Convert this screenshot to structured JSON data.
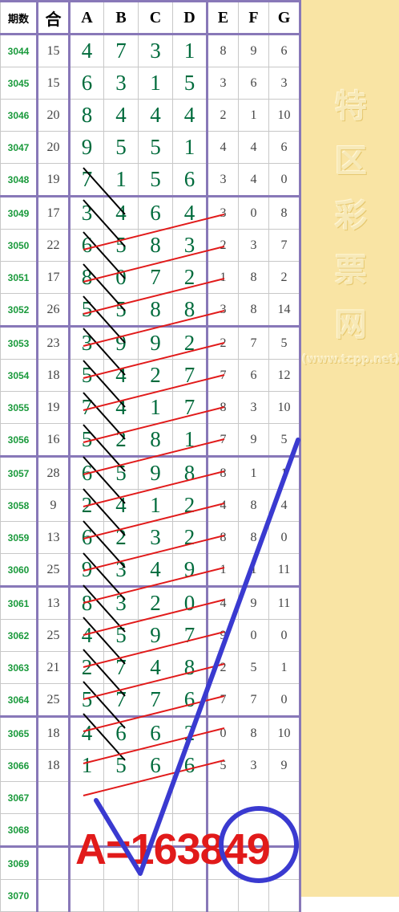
{
  "header": {
    "qi": "期数",
    "he": "合",
    "cols": [
      "A",
      "B",
      "C",
      "D",
      "E",
      "F",
      "G"
    ]
  },
  "rows": [
    {
      "qi": "3044",
      "he": "15",
      "v": [
        "4",
        "7",
        "3",
        "1",
        "8",
        "9",
        "6"
      ]
    },
    {
      "qi": "3045",
      "he": "15",
      "v": [
        "6",
        "3",
        "1",
        "5",
        "3",
        "6",
        "3"
      ]
    },
    {
      "qi": "3046",
      "he": "20",
      "v": [
        "8",
        "4",
        "4",
        "4",
        "2",
        "1",
        "10"
      ]
    },
    {
      "qi": "3047",
      "he": "20",
      "v": [
        "9",
        "5",
        "5",
        "1",
        "4",
        "4",
        "6"
      ]
    },
    {
      "qi": "3048",
      "he": "19",
      "v": [
        "7",
        "1",
        "5",
        "6",
        "3",
        "4",
        "0"
      ]
    },
    {
      "qi": "3049",
      "he": "17",
      "v": [
        "3",
        "4",
        "6",
        "4",
        "3",
        "0",
        "8"
      ]
    },
    {
      "qi": "3050",
      "he": "22",
      "v": [
        "6",
        "5",
        "8",
        "3",
        "2",
        "3",
        "7"
      ]
    },
    {
      "qi": "3051",
      "he": "17",
      "v": [
        "8",
        "0",
        "7",
        "2",
        "1",
        "8",
        "2"
      ]
    },
    {
      "qi": "3052",
      "he": "26",
      "v": [
        "5",
        "5",
        "8",
        "8",
        "3",
        "8",
        "14"
      ]
    },
    {
      "qi": "3053",
      "he": "23",
      "v": [
        "3",
        "9",
        "9",
        "2",
        "2",
        "7",
        "5"
      ]
    },
    {
      "qi": "3054",
      "he": "18",
      "v": [
        "5",
        "4",
        "2",
        "7",
        "7",
        "6",
        "12"
      ]
    },
    {
      "qi": "3055",
      "he": "19",
      "v": [
        "7",
        "4",
        "1",
        "7",
        "8",
        "3",
        "10"
      ]
    },
    {
      "qi": "3056",
      "he": "16",
      "v": [
        "5",
        "2",
        "8",
        "1",
        "7",
        "9",
        "5"
      ]
    },
    {
      "qi": "3057",
      "he": "28",
      "v": [
        "6",
        "5",
        "9",
        "8",
        "8",
        "1",
        "1"
      ]
    },
    {
      "qi": "3058",
      "he": "9",
      "v": [
        "2",
        "4",
        "1",
        "2",
        "4",
        "8",
        "4"
      ]
    },
    {
      "qi": "3059",
      "he": "13",
      "v": [
        "6",
        "2",
        "3",
        "2",
        "8",
        "8",
        "0"
      ]
    },
    {
      "qi": "3060",
      "he": "25",
      "v": [
        "9",
        "3",
        "4",
        "9",
        "1",
        "1",
        "11"
      ]
    },
    {
      "qi": "3061",
      "he": "13",
      "v": [
        "8",
        "3",
        "2",
        "0",
        "4",
        "9",
        "11"
      ]
    },
    {
      "qi": "3062",
      "he": "25",
      "v": [
        "4",
        "5",
        "9",
        "7",
        "9",
        "0",
        "0"
      ]
    },
    {
      "qi": "3063",
      "he": "21",
      "v": [
        "2",
        "7",
        "4",
        "8",
        "2",
        "5",
        "1"
      ]
    },
    {
      "qi": "3064",
      "he": "25",
      "v": [
        "5",
        "7",
        "7",
        "6",
        "7",
        "7",
        "0"
      ]
    },
    {
      "qi": "3065",
      "he": "18",
      "v": [
        "4",
        "6",
        "6",
        "2",
        "0",
        "8",
        "10"
      ]
    },
    {
      "qi": "3066",
      "he": "18",
      "v": [
        "1",
        "5",
        "6",
        "6",
        "5",
        "3",
        "9"
      ]
    },
    {
      "qi": "3067",
      "he": "",
      "v": [
        "",
        "",
        "",
        "",
        "",
        "",
        ""
      ]
    },
    {
      "qi": "3068",
      "he": "",
      "v": [
        "",
        "",
        "",
        "",
        "",
        "",
        ""
      ]
    },
    {
      "qi": "3069",
      "he": "",
      "v": [
        "",
        "",
        "",
        "",
        "",
        "",
        ""
      ]
    },
    {
      "qi": "3070",
      "he": "",
      "v": [
        "",
        "",
        "",
        "",
        "",
        "",
        ""
      ]
    }
  ],
  "group_starts": [
    0,
    5,
    9,
    13,
    17,
    21,
    25
  ],
  "side_panel": {
    "chars": [
      "特",
      "区",
      "彩",
      "票",
      "网"
    ],
    "url": "(www.tcpp.net)"
  },
  "result": {
    "text": "A=163849"
  },
  "colors": {
    "digit_green": "#006b3c",
    "period_green": "#1a9a3c",
    "red_line": "#e11a1a",
    "blue_check": "#3a3ad0",
    "panel_yellow": "#f9e4a4",
    "separator_purple": "#8878b8"
  }
}
